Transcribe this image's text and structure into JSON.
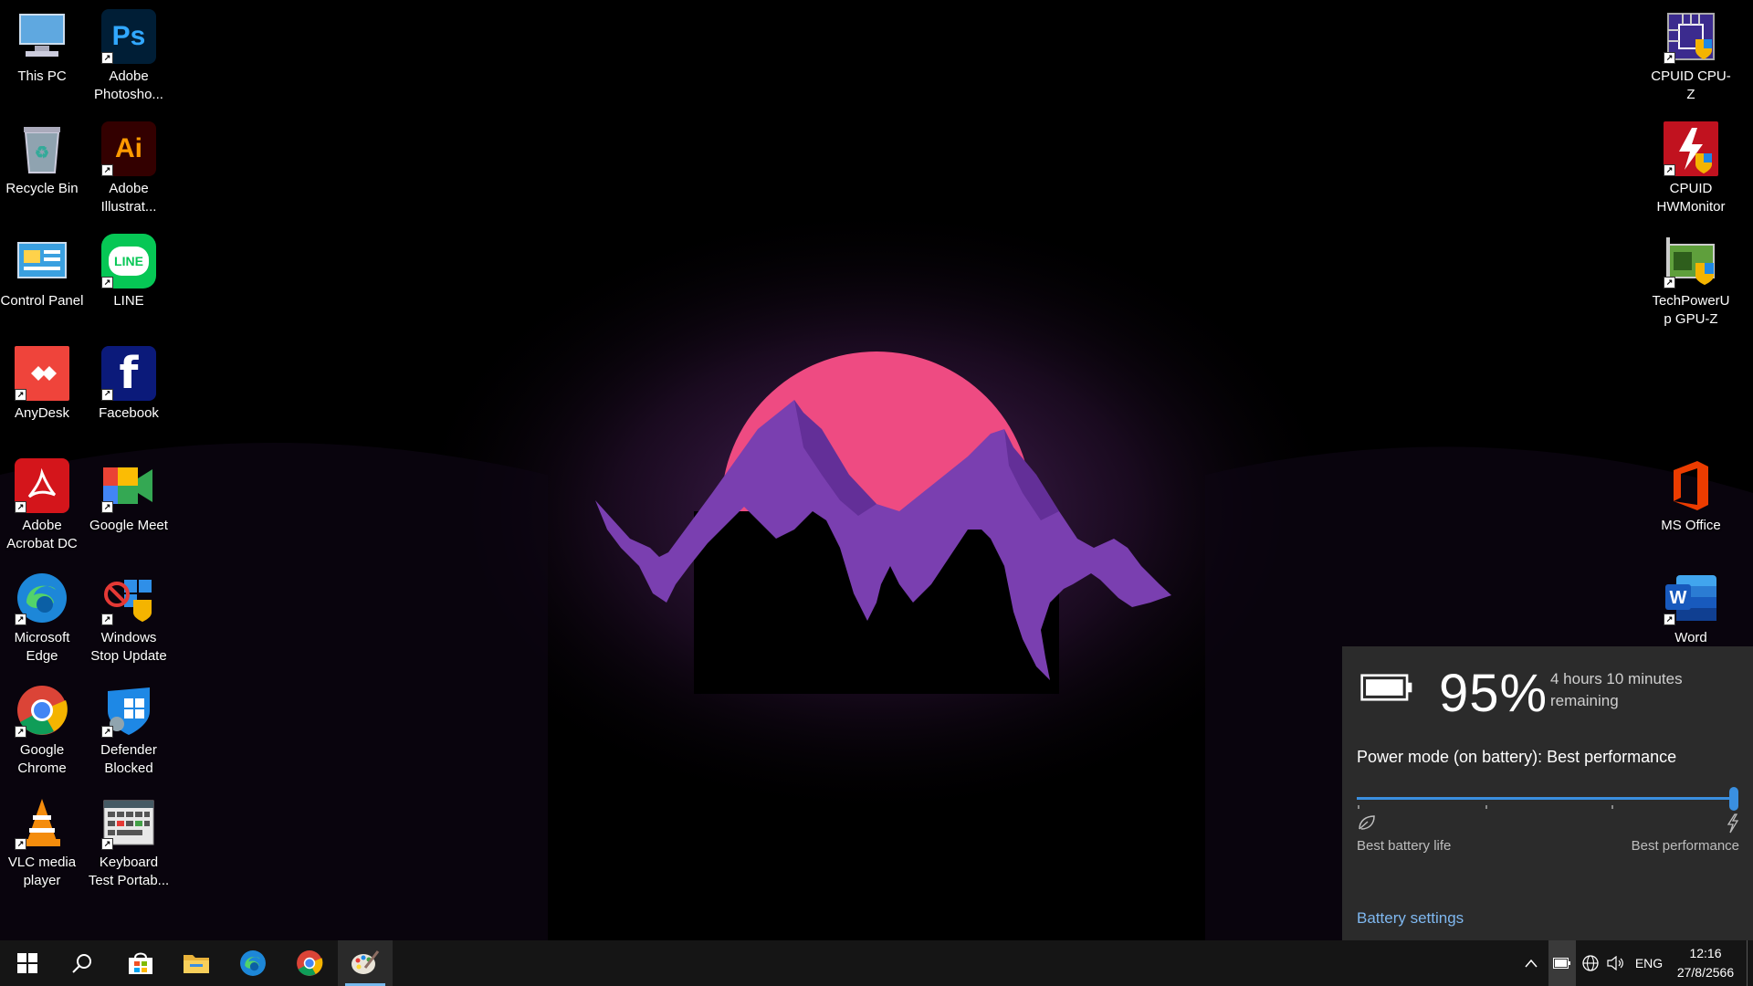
{
  "desktop": {
    "left_column_1": [
      {
        "label": "This PC",
        "icon": "computer-icon"
      },
      {
        "label": "Recycle Bin",
        "icon": "recycle-bin-icon"
      },
      {
        "label": "Control Panel",
        "icon": "control-panel-icon"
      },
      {
        "label": "AnyDesk",
        "icon": "anydesk-icon"
      },
      {
        "label": "Adobe Acrobat DC",
        "icon": "acrobat-icon"
      },
      {
        "label": "Microsoft Edge",
        "icon": "edge-icon"
      },
      {
        "label": "Google Chrome",
        "icon": "chrome-icon"
      },
      {
        "label": "VLC media player",
        "icon": "vlc-icon"
      }
    ],
    "left_column_2": [
      {
        "label": "Adobe Photosho...",
        "icon": "photoshop-icon",
        "glyph": "Ps"
      },
      {
        "label": "Adobe Illustrat...",
        "icon": "illustrator-icon",
        "glyph": "Ai"
      },
      {
        "label": "LINE",
        "icon": "line-icon",
        "glyph": "LINE"
      },
      {
        "label": "Facebook",
        "icon": "facebook-icon",
        "glyph": "f"
      },
      {
        "label": "Google Meet",
        "icon": "google-meet-icon"
      },
      {
        "label": "Windows Stop Update",
        "icon": "windows-stop-update-icon"
      },
      {
        "label": "Defender Blocked",
        "icon": "defender-blocked-icon"
      },
      {
        "label": "Keyboard Test Portab...",
        "icon": "keyboard-test-icon"
      }
    ],
    "right_column": [
      {
        "label": "CPUID CPU-Z",
        "icon": "cpu-z-icon"
      },
      {
        "label": "CPUID HWMonitor",
        "icon": "hwmonitor-icon"
      },
      {
        "label": "TechPowerUp GPU-Z",
        "icon": "gpu-z-icon"
      },
      {
        "label": "MS Office",
        "icon": "ms-office-icon"
      },
      {
        "label": "Word",
        "icon": "word-icon",
        "glyph": "W"
      }
    ]
  },
  "battery_flyout": {
    "percent": "95%",
    "remaining": "4 hours 10 minutes remaining",
    "power_mode_label": "Power mode (on battery): Best performance",
    "slider_value": 1.0,
    "left_label": "Best battery life",
    "right_label": "Best performance",
    "settings_link": "Battery settings"
  },
  "taskbar": {
    "pinned": [
      "start-icon",
      "search-icon",
      "microsoft-store-icon",
      "file-explorer-icon",
      "edge-icon",
      "chrome-icon",
      "paint-icon"
    ],
    "language": "ENG",
    "time": "12:16",
    "date": "27/8/2566"
  },
  "colors": {
    "accent": "#3a8fe0",
    "sun": "#ee4b82",
    "mountain": "#7a3fb0",
    "flyout_bg": "#2b2b2b",
    "taskbar_bg": "#151515"
  }
}
